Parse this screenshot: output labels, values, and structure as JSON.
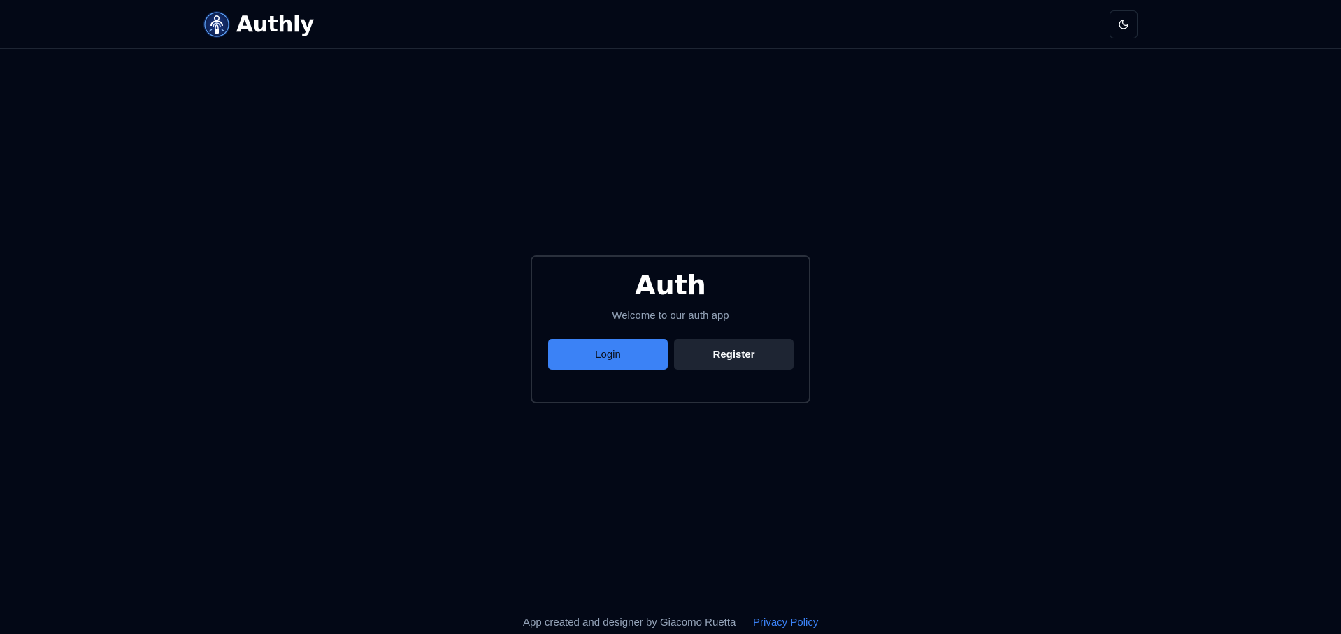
{
  "header": {
    "brand_name": "Authly",
    "logo_icon": "fingerprint-lock-logo",
    "theme_toggle_icon": "moon-icon"
  },
  "card": {
    "title": "Auth",
    "subtitle": "Welcome to our auth app",
    "login_label": "Login",
    "register_label": "Register"
  },
  "footer": {
    "credit": "App created and designer by Giacomo Ruetta",
    "privacy_link": "Privacy Policy"
  },
  "colors": {
    "background": "#030816",
    "accent": "#3b82f6",
    "secondary_button": "#1e2533",
    "muted_text": "#94a3b8"
  }
}
